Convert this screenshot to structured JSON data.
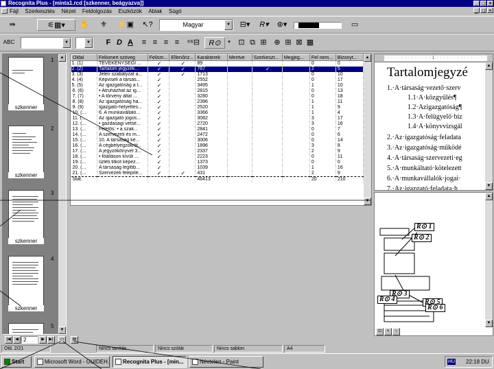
{
  "window": {
    "title": "Recognita Plus - [minta1.rcd [szkenner, beágyazva]]"
  },
  "menu": [
    "Fájl",
    "Szerkesztés",
    "Nézet",
    "Feldolgozás",
    "Eszközök",
    "Ablak",
    "Súgó"
  ],
  "toolbar1": {
    "language_combo": "Magyar"
  },
  "toolbar2": {
    "font_buttons": [
      "F",
      "D",
      "A"
    ]
  },
  "thumbnails": {
    "pages": [
      {
        "number": "1",
        "label": "szkenner"
      },
      {
        "number": "2",
        "label": "szkenner"
      },
      {
        "number": "3",
        "label": "szkenner"
      },
      {
        "number": "4",
        "label": "szkenner"
      },
      {
        "number": "5",
        "label": ""
      }
    ],
    "page_input": "2"
  },
  "grid": {
    "headers": [
      "Oldal",
      "Felismert szöveg",
      "Felism...",
      "Ellenőriz...",
      "Karakterek",
      "Mentve",
      "Szerkeszt...",
      "Megjeg...",
      "Fel nem...",
      "Bizonyt..."
    ],
    "rows": [
      {
        "page": "1. (1)",
        "text": "TEVÉKENYSÉGI ...",
        "f": "✓",
        "e": "✓",
        "chars": "89",
        "m": "",
        "s": "",
        "mj": "",
        "fn": "0",
        "b": "0"
      },
      {
        "page": "2. (2)",
        "text": "Tartalom jegyzék...",
        "f": "✓",
        "e": "✓",
        "chars": "767",
        "m": "",
        "s": "✓",
        "mj": "",
        "fn": "2",
        "b": "5"
      },
      {
        "page": "3. (3)",
        "text": "Jelen szabályzat a...",
        "f": "✓",
        "e": "✓",
        "chars": "1713",
        "m": "",
        "s": "",
        "mj": "",
        "fn": "0",
        "b": "10"
      },
      {
        "page": "4. (4)",
        "text": "Képviseli a társas...",
        "f": "✓",
        "e": "",
        "chars": "2552",
        "m": "",
        "s": "",
        "mj": "",
        "fn": "0",
        "b": "17"
      },
      {
        "page": "5. (5)",
        "text": "Az igazgatóság a t...",
        "f": "✓",
        "e": "",
        "chars": "3495",
        "m": "",
        "s": "",
        "mj": "",
        "fn": "1",
        "b": "10"
      },
      {
        "page": "6. (6)",
        "text": "• Átruházhat az ig...",
        "f": "✓",
        "e": "",
        "chars": "2815",
        "m": "",
        "s": "",
        "mj": "",
        "fn": "0",
        "b": "13"
      },
      {
        "page": "7. (7)",
        "text": "• A törvény által ...",
        "f": "✓",
        "e": "",
        "chars": "3280",
        "m": "",
        "s": "",
        "mj": "",
        "fn": "0",
        "b": "18"
      },
      {
        "page": "8. (8)",
        "text": "Az igazgatóság ha...",
        "f": "✓",
        "e": "",
        "chars": "2396",
        "m": "",
        "s": "",
        "mj": "",
        "fn": "1",
        "b": "11"
      },
      {
        "page": "9. (9)",
        "text": "Igazgató-helyettes...",
        "f": "✓",
        "e": "",
        "chars": "2520",
        "m": "",
        "s": "",
        "mj": "",
        "fn": "1",
        "b": "9"
      },
      {
        "page": "10. (...",
        "text": "6. A munkavállaló...",
        "f": "✓",
        "e": "",
        "chars": "3366",
        "m": "",
        "s": "",
        "mj": "",
        "fn": "1",
        "b": "4"
      },
      {
        "page": "11. (...",
        "text": "Az igazgató jogos...",
        "f": "✓",
        "e": "",
        "chars": "3082",
        "m": "",
        "s": "",
        "mj": "",
        "fn": "3",
        "b": "17"
      },
      {
        "page": "12. (...",
        "text": "• gazdasági vétsé...",
        "f": "✓",
        "e": "",
        "chars": "2720",
        "m": "",
        "s": "",
        "mj": "",
        "fn": "3",
        "b": "16"
      },
      {
        "page": "13. (...",
        "text": "Felelős: • a szak...",
        "f": "✓",
        "e": "",
        "chars": "2841",
        "m": "",
        "s": "",
        "mj": "",
        "fn": "0",
        "b": "7"
      },
      {
        "page": "14. (...",
        "text": "A szervezeti és m...",
        "f": "✓",
        "e": "",
        "chars": "2472",
        "m": "",
        "s": "",
        "mj": "",
        "fn": "0",
        "b": "6"
      },
      {
        "page": "15. (...",
        "text": "10. A társaság ké...",
        "f": "✓",
        "e": "",
        "chars": "3006",
        "m": "",
        "s": "",
        "mj": "",
        "fn": "0",
        "b": "14"
      },
      {
        "page": "16. (...",
        "text": "A cégbélyegzőkről...",
        "f": "✓",
        "e": "",
        "chars": "1896",
        "m": "",
        "s": "",
        "mj": "",
        "fn": "3",
        "b": "8"
      },
      {
        "page": "17. (...",
        "text": "A jegyzőkönyvet 3...",
        "f": "✓",
        "e": "",
        "chars": "2337",
        "m": "",
        "s": "",
        "mj": "",
        "fn": "2",
        "b": "9"
      },
      {
        "page": "18. (...",
        "text": "• főálláson kívüli ...",
        "f": "✓",
        "e": "",
        "chars": "2223",
        "m": "",
        "s": "",
        "mj": "",
        "fn": "0",
        "b": "11"
      },
      {
        "page": "19. (...",
        "text": "üzleti titkot képez...",
        "f": "✓",
        "e": "",
        "chars": "1373",
        "m": "",
        "s": "",
        "mj": "",
        "fn": "0",
        "b": "0"
      },
      {
        "page": "20. (...",
        "text": "A társaság legfőb...",
        "f": "✓",
        "e": "",
        "chars": "1039",
        "m": "",
        "s": "",
        "mj": "",
        "fn": "1",
        "b": "16"
      },
      {
        "page": "21. (...",
        "text": "Szervezeti felépíté...",
        "f": "✓",
        "e": "✓",
        "chars": "431",
        "m": "",
        "s": "",
        "mj": "",
        "fn": "2",
        "b": "9"
      }
    ],
    "total": {
      "page": "Stat.",
      "chars": "46413",
      "fn": "20",
      "b": "210"
    }
  },
  "document": {
    "lines": [
      "Tartalomjegyzé",
      "1.·A·társaság·vezető·szerv",
      "1.1·A·közgyűlés¶",
      "1.2·Azigazgatóság¶",
      "1.3·A·felügyelő·biz",
      "1.4·A·könyvvizsgál",
      "2.·Az·igazgatóság·feladata",
      "3.·Az·igazgatóság·működé",
      "4.·A·társaság·szervezeti·eg",
      "5.·A·munkáltató·kötelezett",
      "6.·A·munkavállalók·jogai·",
      "7.·Az·igazgató·feladata·h"
    ]
  },
  "preview": {
    "regions": [
      "R⊙ 1",
      "R⊙ 2",
      "R⊙ 3",
      "R⊙ 4",
      "R⊙ 5",
      "R⊙ 6"
    ]
  },
  "status": {
    "page_info": "Old. 2/21",
    "training": "Nincs tanítás",
    "dictionary": "Nincs szótár",
    "template": "Nincs sablon",
    "paper": "A4"
  },
  "taskbar": {
    "start": "Start",
    "tasks": [
      "Microsoft Word - GUIDEH...",
      "Recognita Plus - [min...",
      "Névtelen - Paint"
    ],
    "lang": "HU",
    "clock": "22:18 DU"
  }
}
